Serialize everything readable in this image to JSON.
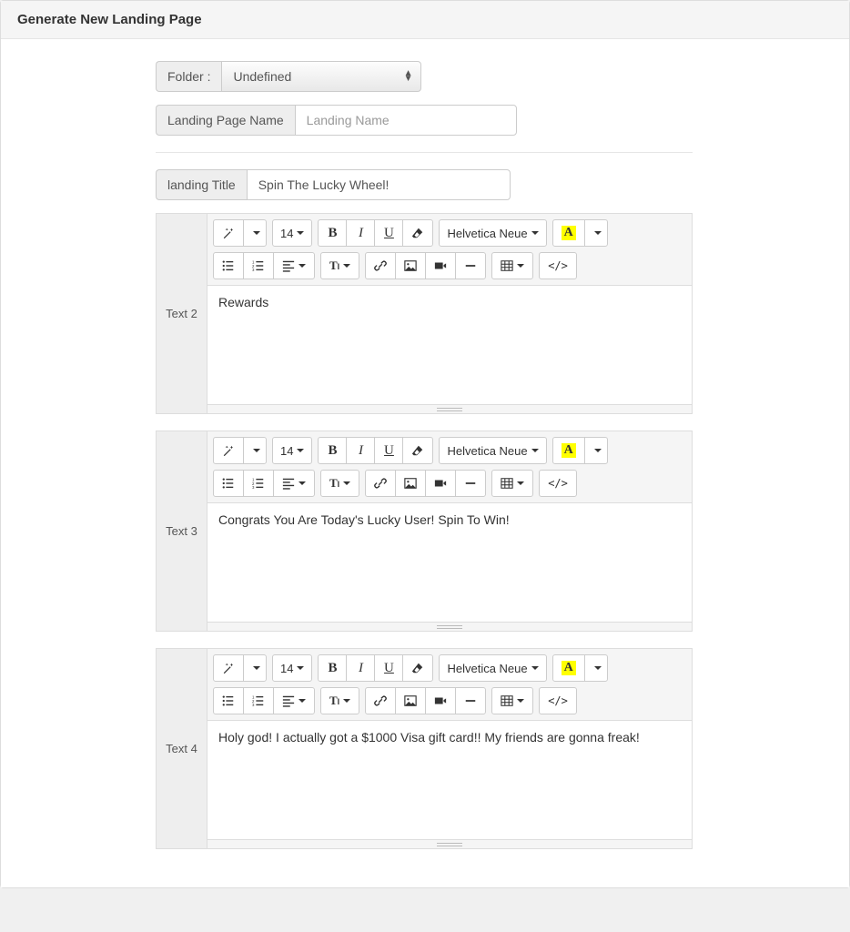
{
  "header": {
    "title": "Generate New Landing Page"
  },
  "form": {
    "folder_label": "Folder :",
    "folder_selected": "Undefined",
    "landing_name_label": "Landing Page Name",
    "landing_name_placeholder": "Landing Name",
    "landing_name_value": "",
    "landing_title_label": "landing Title",
    "landing_title_value": "Spin The Lucky Wheel!"
  },
  "toolbar": {
    "font_size": "14",
    "font_family": "Helvetica Neue"
  },
  "editors": [
    {
      "label": "Text 2",
      "content": "Rewards"
    },
    {
      "label": "Text 3",
      "content": "Congrats You Are Today's Lucky User! Spin To Win!"
    },
    {
      "label": "Text 4",
      "content": "Holy god! I actually got a $1000 Visa gift card!! My friends are gonna freak!"
    }
  ]
}
